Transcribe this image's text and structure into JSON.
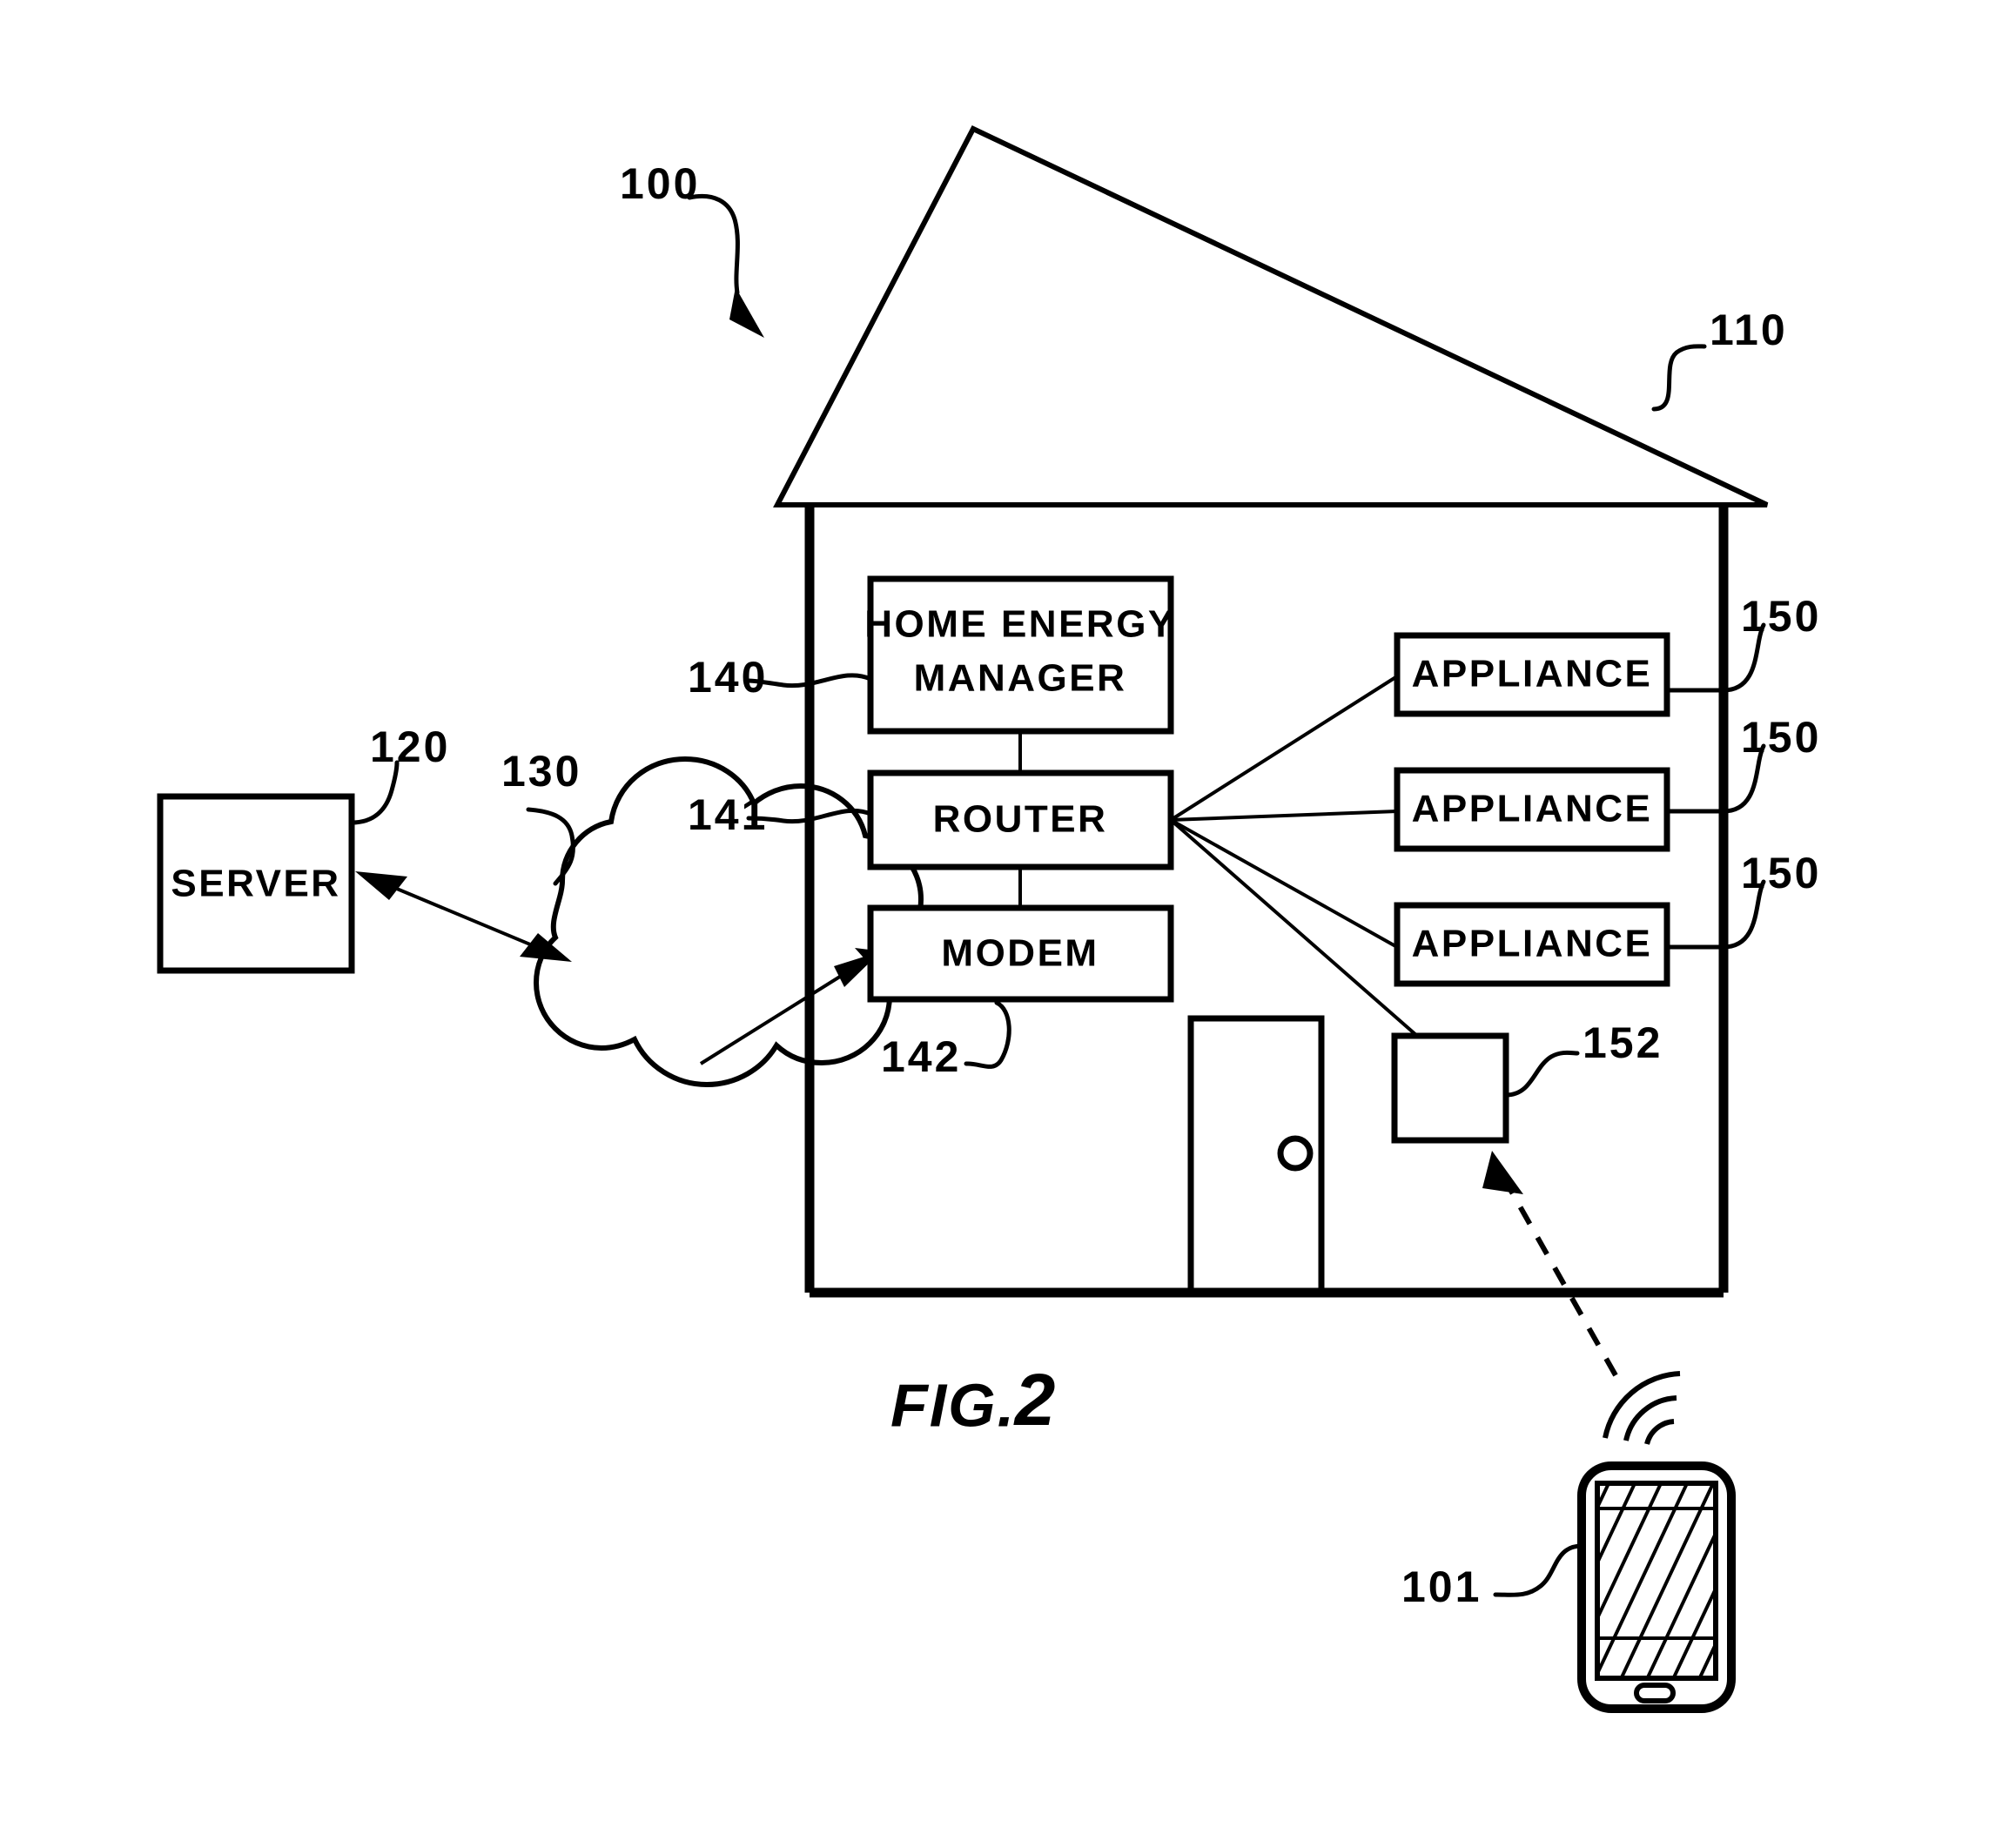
{
  "figure": {
    "caption_prefix": "FIG.",
    "caption_number": "2",
    "system_ref": "100"
  },
  "nodes": {
    "server": {
      "label": "SERVER",
      "ref": "120"
    },
    "network_cloud": {
      "label": "",
      "ref": "130",
      "icon": "cloud-icon"
    },
    "home": {
      "label": "",
      "ref": "110",
      "icon": "house-icon"
    },
    "home_energy_manager": {
      "label": "HOME ENERGY\nMANAGER",
      "line1": "HOME ENERGY",
      "line2": "MANAGER",
      "ref": "140"
    },
    "router": {
      "label": "ROUTER",
      "ref": "141"
    },
    "modem": {
      "label": "MODEM",
      "ref": "142"
    },
    "appliance_1": {
      "label": "APPLIANCE",
      "ref": "150"
    },
    "appliance_2": {
      "label": "APPLIANCE",
      "ref": "150"
    },
    "appliance_3": {
      "label": "APPLIANCE",
      "ref": "150"
    },
    "local_device": {
      "label": "",
      "ref": "152"
    },
    "mobile_device": {
      "label": "",
      "ref": "101",
      "icon": "smartphone-icon"
    },
    "door": {
      "label": "",
      "ref": "",
      "icon": "door-icon"
    }
  },
  "connections": [
    {
      "from": "server",
      "to": "network_cloud",
      "style": "solid",
      "arrows": "both"
    },
    {
      "from": "network_cloud",
      "to": "modem",
      "style": "solid",
      "arrows": "both"
    },
    {
      "from": "home_energy_manager",
      "to": "router",
      "style": "solid",
      "arrows": "none"
    },
    {
      "from": "router",
      "to": "modem",
      "style": "solid",
      "arrows": "none"
    },
    {
      "from": "router",
      "to": "appliance_1",
      "style": "solid",
      "arrows": "none"
    },
    {
      "from": "router",
      "to": "appliance_2",
      "style": "solid",
      "arrows": "none"
    },
    {
      "from": "router",
      "to": "appliance_3",
      "style": "solid",
      "arrows": "none"
    },
    {
      "from": "router",
      "to": "local_device",
      "style": "solid",
      "arrows": "none"
    },
    {
      "from": "mobile_device",
      "to": "local_device",
      "style": "dashed",
      "arrows": "to"
    }
  ],
  "colors": {
    "stroke": "#000000",
    "background": "#ffffff"
  }
}
